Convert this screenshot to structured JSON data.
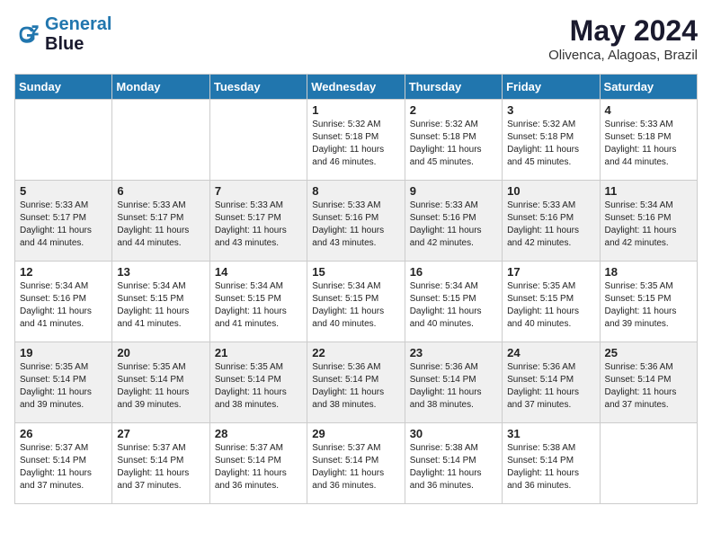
{
  "header": {
    "logo_line1": "General",
    "logo_line2": "Blue",
    "main_title": "May 2024",
    "subtitle": "Olivenca, Alagoas, Brazil"
  },
  "weekdays": [
    "Sunday",
    "Monday",
    "Tuesday",
    "Wednesday",
    "Thursday",
    "Friday",
    "Saturday"
  ],
  "weeks": [
    [
      {
        "day": "",
        "info": ""
      },
      {
        "day": "",
        "info": ""
      },
      {
        "day": "",
        "info": ""
      },
      {
        "day": "1",
        "info": "Sunrise: 5:32 AM\nSunset: 5:18 PM\nDaylight: 11 hours\nand 46 minutes."
      },
      {
        "day": "2",
        "info": "Sunrise: 5:32 AM\nSunset: 5:18 PM\nDaylight: 11 hours\nand 45 minutes."
      },
      {
        "day": "3",
        "info": "Sunrise: 5:32 AM\nSunset: 5:18 PM\nDaylight: 11 hours\nand 45 minutes."
      },
      {
        "day": "4",
        "info": "Sunrise: 5:33 AM\nSunset: 5:18 PM\nDaylight: 11 hours\nand 44 minutes."
      }
    ],
    [
      {
        "day": "5",
        "info": "Sunrise: 5:33 AM\nSunset: 5:17 PM\nDaylight: 11 hours\nand 44 minutes."
      },
      {
        "day": "6",
        "info": "Sunrise: 5:33 AM\nSunset: 5:17 PM\nDaylight: 11 hours\nand 44 minutes."
      },
      {
        "day": "7",
        "info": "Sunrise: 5:33 AM\nSunset: 5:17 PM\nDaylight: 11 hours\nand 43 minutes."
      },
      {
        "day": "8",
        "info": "Sunrise: 5:33 AM\nSunset: 5:16 PM\nDaylight: 11 hours\nand 43 minutes."
      },
      {
        "day": "9",
        "info": "Sunrise: 5:33 AM\nSunset: 5:16 PM\nDaylight: 11 hours\nand 42 minutes."
      },
      {
        "day": "10",
        "info": "Sunrise: 5:33 AM\nSunset: 5:16 PM\nDaylight: 11 hours\nand 42 minutes."
      },
      {
        "day": "11",
        "info": "Sunrise: 5:34 AM\nSunset: 5:16 PM\nDaylight: 11 hours\nand 42 minutes."
      }
    ],
    [
      {
        "day": "12",
        "info": "Sunrise: 5:34 AM\nSunset: 5:16 PM\nDaylight: 11 hours\nand 41 minutes."
      },
      {
        "day": "13",
        "info": "Sunrise: 5:34 AM\nSunset: 5:15 PM\nDaylight: 11 hours\nand 41 minutes."
      },
      {
        "day": "14",
        "info": "Sunrise: 5:34 AM\nSunset: 5:15 PM\nDaylight: 11 hours\nand 41 minutes."
      },
      {
        "day": "15",
        "info": "Sunrise: 5:34 AM\nSunset: 5:15 PM\nDaylight: 11 hours\nand 40 minutes."
      },
      {
        "day": "16",
        "info": "Sunrise: 5:34 AM\nSunset: 5:15 PM\nDaylight: 11 hours\nand 40 minutes."
      },
      {
        "day": "17",
        "info": "Sunrise: 5:35 AM\nSunset: 5:15 PM\nDaylight: 11 hours\nand 40 minutes."
      },
      {
        "day": "18",
        "info": "Sunrise: 5:35 AM\nSunset: 5:15 PM\nDaylight: 11 hours\nand 39 minutes."
      }
    ],
    [
      {
        "day": "19",
        "info": "Sunrise: 5:35 AM\nSunset: 5:14 PM\nDaylight: 11 hours\nand 39 minutes."
      },
      {
        "day": "20",
        "info": "Sunrise: 5:35 AM\nSunset: 5:14 PM\nDaylight: 11 hours\nand 39 minutes."
      },
      {
        "day": "21",
        "info": "Sunrise: 5:35 AM\nSunset: 5:14 PM\nDaylight: 11 hours\nand 38 minutes."
      },
      {
        "day": "22",
        "info": "Sunrise: 5:36 AM\nSunset: 5:14 PM\nDaylight: 11 hours\nand 38 minutes."
      },
      {
        "day": "23",
        "info": "Sunrise: 5:36 AM\nSunset: 5:14 PM\nDaylight: 11 hours\nand 38 minutes."
      },
      {
        "day": "24",
        "info": "Sunrise: 5:36 AM\nSunset: 5:14 PM\nDaylight: 11 hours\nand 37 minutes."
      },
      {
        "day": "25",
        "info": "Sunrise: 5:36 AM\nSunset: 5:14 PM\nDaylight: 11 hours\nand 37 minutes."
      }
    ],
    [
      {
        "day": "26",
        "info": "Sunrise: 5:37 AM\nSunset: 5:14 PM\nDaylight: 11 hours\nand 37 minutes."
      },
      {
        "day": "27",
        "info": "Sunrise: 5:37 AM\nSunset: 5:14 PM\nDaylight: 11 hours\nand 37 minutes."
      },
      {
        "day": "28",
        "info": "Sunrise: 5:37 AM\nSunset: 5:14 PM\nDaylight: 11 hours\nand 36 minutes."
      },
      {
        "day": "29",
        "info": "Sunrise: 5:37 AM\nSunset: 5:14 PM\nDaylight: 11 hours\nand 36 minutes."
      },
      {
        "day": "30",
        "info": "Sunrise: 5:38 AM\nSunset: 5:14 PM\nDaylight: 11 hours\nand 36 minutes."
      },
      {
        "day": "31",
        "info": "Sunrise: 5:38 AM\nSunset: 5:14 PM\nDaylight: 11 hours\nand 36 minutes."
      },
      {
        "day": "",
        "info": ""
      }
    ]
  ]
}
